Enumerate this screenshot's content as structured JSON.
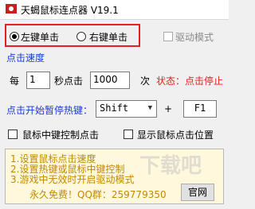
{
  "window": {
    "title": "天蝎鼠标连点器  V19.1"
  },
  "mouse_buttons": {
    "left_label": "左键单击",
    "right_label": "右键单击",
    "selected": "left"
  },
  "drive_mode": {
    "label": "驱动模式",
    "enabled": false
  },
  "speed": {
    "section_label": "点击速度",
    "every_label": "每",
    "seconds_value": "1",
    "per_second_label": "秒点击",
    "count_value": "1000",
    "times_label": "次",
    "status_label": "状态：点击停止"
  },
  "hotkey": {
    "label": "点击开始暂停热键：",
    "key": "Shift",
    "plus": "+",
    "fkey": "F1"
  },
  "options": {
    "middle_button": "鼠标中键控制点击",
    "show_position": "显示鼠标点击位置"
  },
  "info": {
    "lines": [
      "1.设置鼠标点击速度",
      "2.设置热键或鼠标中键控制",
      "3.游戏中无效时开启驱动模式"
    ],
    "free_text": "永久免费！QQ群：259779350",
    "website_button": "官网"
  },
  "watermark": "下载吧",
  "colors": {
    "red_border": "#e81f1f",
    "blue": "#1a3cd4",
    "info_text": "#c28a00",
    "status": "#e81f1f"
  }
}
